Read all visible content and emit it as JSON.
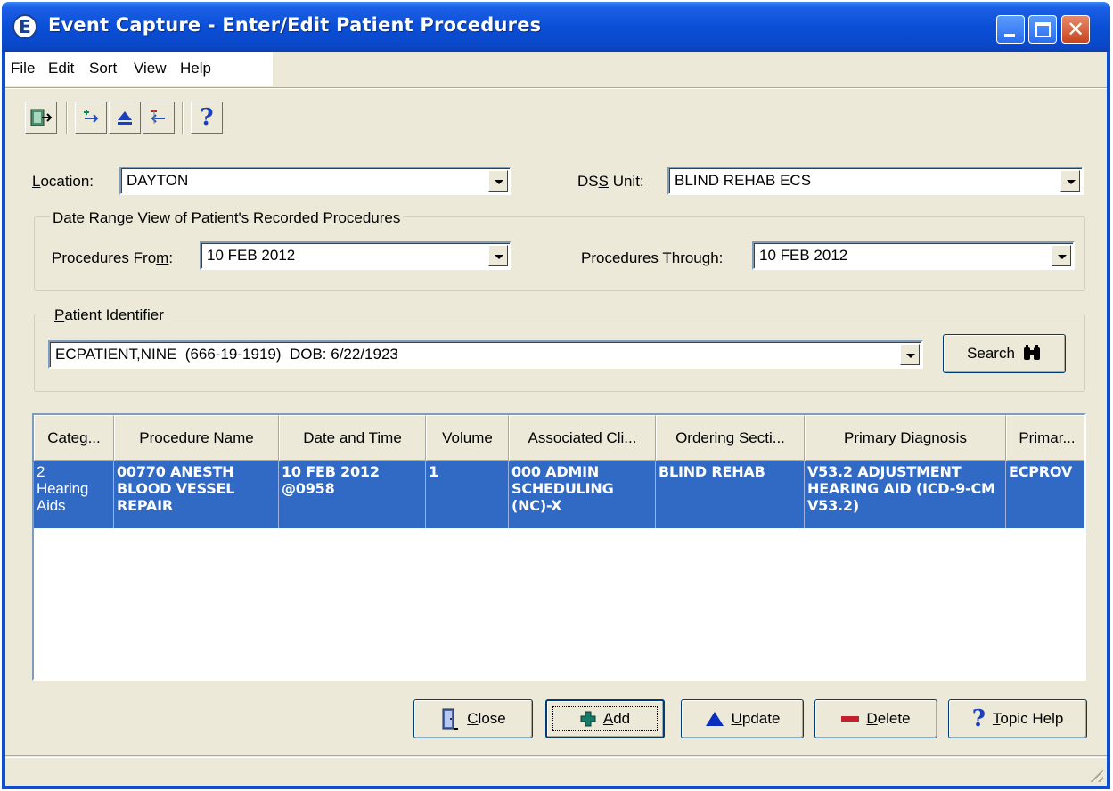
{
  "window": {
    "title": "Event Capture - Enter/Edit Patient Procedures",
    "icon_letter": "E"
  },
  "menu": [
    "File",
    "Edit",
    "Sort",
    "View",
    "Help"
  ],
  "toolbar": {
    "tools": [
      "exit-icon",
      "move-up-icon",
      "eject-icon",
      "move-back-icon",
      "help-question-icon"
    ],
    "help_glyph": "?"
  },
  "location": {
    "label_prefix": "L",
    "label_rest": "ocation:",
    "value": "DAYTON"
  },
  "dss_unit": {
    "label_pre": "DS",
    "label_u": "S",
    "label_post": " Unit:",
    "value": "BLIND REHAB ECS"
  },
  "date_range": {
    "title": "Date Range View of Patient's Recorded Procedures",
    "from_label_pre": "Procedures Fro",
    "from_label_u": "m",
    "from_label_post": ":",
    "from_value": "10 FEB 2012",
    "through_label": "Procedures Through:",
    "through_value": "10 FEB 2012"
  },
  "patient": {
    "title_u": "P",
    "title_rest": "atient Identifier",
    "value": "ECPATIENT,NINE  (666-19-1919)  DOB: 6/22/1923",
    "search_label": "Search"
  },
  "grid": {
    "columns": [
      "Categ...",
      "Procedure Name",
      "Date and Time",
      "Volume",
      "Associated Cli...",
      "Ordering Secti...",
      "Primary Diagnosis",
      "Primar..."
    ],
    "rows": [
      {
        "category": "2\nHearing\nAids",
        "procedure": "00770 ANESTH BLOOD VESSEL REPAIR",
        "datetime": "10 FEB 2012 @0958",
        "volume": "1",
        "clinic": "000 ADMIN SCHEDULING (NC)-X",
        "section": "BLIND REHAB",
        "diagnosis": "V53.2 ADJUSTMENT HEARING AID (ICD-9-CM V53.2)",
        "provider": "ECPROV"
      }
    ]
  },
  "buttons": {
    "close": {
      "u": "C",
      "rest": "lose"
    },
    "add": {
      "u": "A",
      "rest": "dd"
    },
    "update": {
      "u": "U",
      "rest": "pdate"
    },
    "delete": {
      "u": "D",
      "rest": "elete"
    },
    "topic_help": {
      "u": "T",
      "rest": "opic Help"
    }
  },
  "colors": {
    "titlebar": "#0a4fd6",
    "selection": "#316ac5",
    "dialog_bg": "#ece9d8"
  }
}
